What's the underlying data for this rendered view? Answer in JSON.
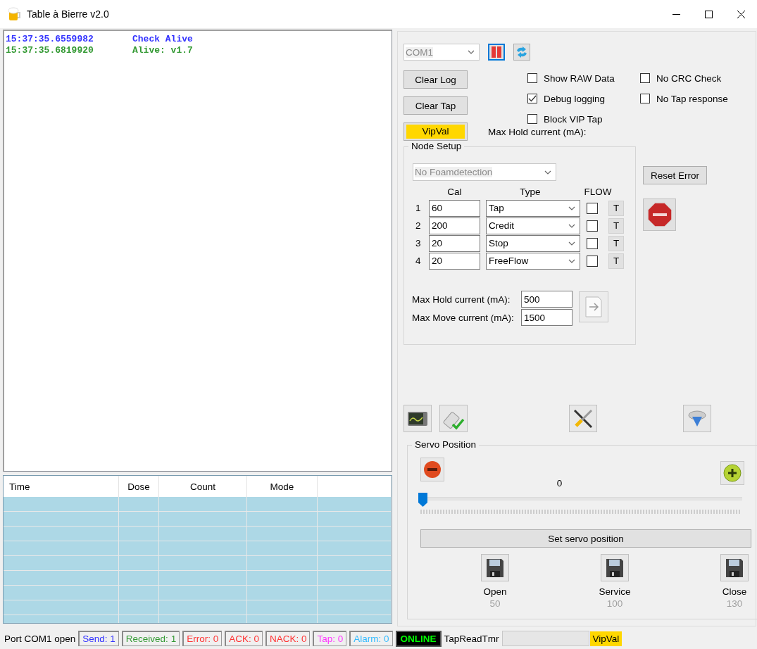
{
  "window": {
    "title": "Table à Bierre v2.0"
  },
  "log": [
    {
      "time": "15:37:35.6559982",
      "message": "Check Alive",
      "color": "#3333ff"
    },
    {
      "time": "15:37:35.6819920",
      "message": "Alive: v1.7",
      "color": "#339933"
    }
  ],
  "table": {
    "columns": [
      "Time",
      "Dose",
      "Count",
      "Mode"
    ]
  },
  "port": {
    "value": "COM1",
    "disabled": true
  },
  "buttons": [
    {
      "label": "Clear Log",
      "highlighted": false
    },
    {
      "label": "Clear Tap",
      "highlighted": false
    },
    {
      "label": "VipVal",
      "highlighted": true
    }
  ],
  "checkboxes": [
    [
      {
        "label": "Show RAW Data",
        "checked": false
      },
      {
        "label": "Debug logging",
        "checked": true
      },
      {
        "label": "Block VIP Tap",
        "checked": false
      }
    ],
    [
      {
        "label": "No CRC Check",
        "checked": false
      },
      {
        "label": "No Tap response",
        "checked": false
      }
    ]
  ],
  "max_hold_label": "Max Hold current (mA):",
  "node_setup": {
    "title": "Node Setup",
    "foam": {
      "value": "No Foamdetection",
      "disabled": true
    },
    "headers": [
      "Cal",
      "Type",
      "FLOW"
    ],
    "nodes": [
      {
        "index": "1",
        "cal": "60",
        "type": "Tap",
        "flow": false,
        "test": "T"
      },
      {
        "index": "2",
        "cal": "200",
        "type": "Credit",
        "flow": false,
        "test": "T"
      },
      {
        "index": "3",
        "cal": "20",
        "type": "Stop",
        "flow": false,
        "test": "T"
      },
      {
        "index": "4",
        "cal": "20",
        "type": "FreeFlow",
        "flow": false,
        "test": "T"
      }
    ],
    "hold": {
      "label": "Max Hold current (mA):",
      "value": "500"
    },
    "move": {
      "label": "Max Move current (mA):",
      "value": "1500"
    }
  },
  "reset_error": "Reset Error",
  "servo": {
    "title": "Servo Position",
    "value": "0",
    "level": 0,
    "set_button": "Set servo position",
    "presets": [
      {
        "label": "Open",
        "value": "50"
      },
      {
        "label": "Service",
        "value": "100"
      },
      {
        "label": "Close",
        "value": "130"
      }
    ]
  },
  "status_bar": {
    "port": "Port COM1 open",
    "counters": [
      {
        "text": "Send: 1",
        "color": "#3333ff"
      },
      {
        "text": "Received: 1",
        "color": "#339933"
      },
      {
        "text": "Error: 0",
        "color": "#ff3333"
      },
      {
        "text": "ACK: 0",
        "color": "#ff3333"
      },
      {
        "text": "NACK: 0",
        "color": "#ff3333"
      },
      {
        "text": "Tap: 0",
        "color": "#ff33ff"
      },
      {
        "text": "Alarm: 0",
        "color": "#33bbff"
      }
    ],
    "online": "ONLINE",
    "timer_label": "TapReadTmr",
    "vip": "VipVal"
  }
}
